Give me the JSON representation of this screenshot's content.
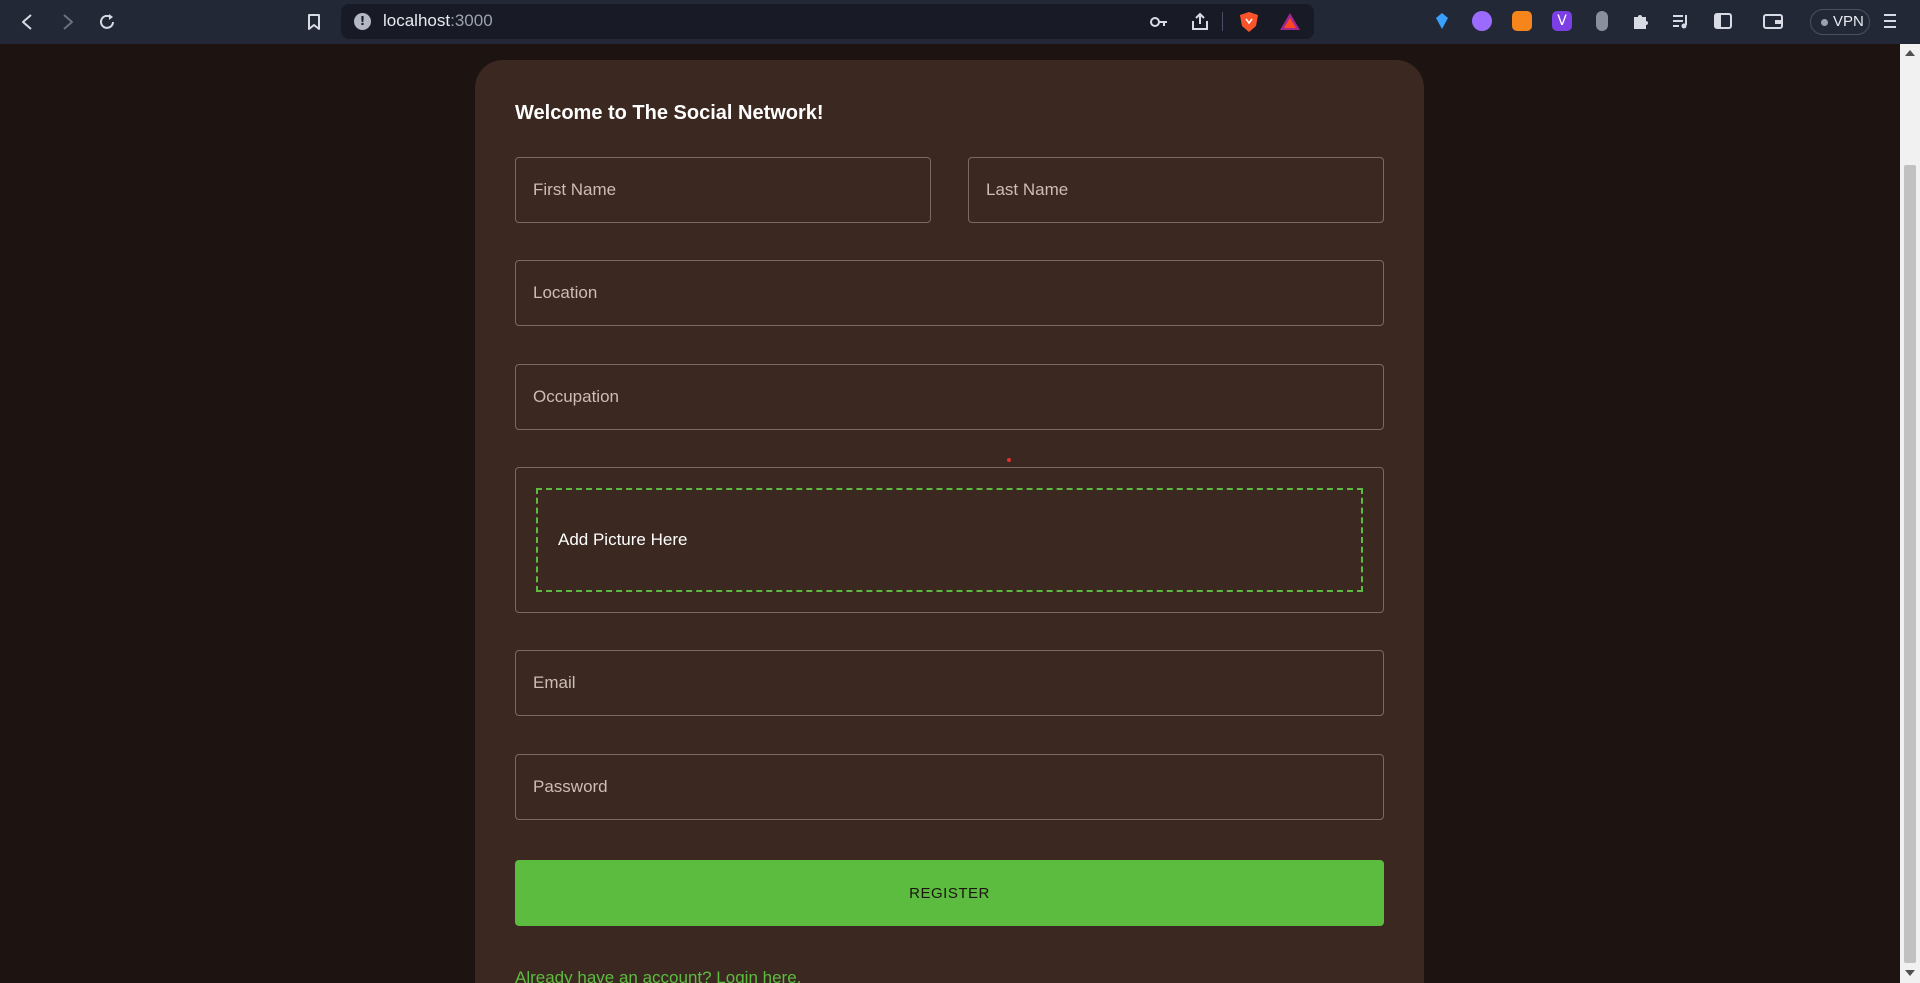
{
  "browser": {
    "url_host": "localhost",
    "url_port": ":3000",
    "vpn_label": "VPN"
  },
  "form": {
    "title": "Welcome to The Social Network!",
    "first_name_placeholder": "First Name",
    "last_name_placeholder": "Last Name",
    "location_placeholder": "Location",
    "occupation_placeholder": "Occupation",
    "picture_label": "Add Picture Here",
    "email_placeholder": "Email",
    "password_placeholder": "Password",
    "register_label": "REGISTER",
    "login_link": "Already have an account? Login here."
  },
  "colors": {
    "page_bg": "#1d1411",
    "card_bg": "#3b2820",
    "accent": "#5cbc40"
  }
}
